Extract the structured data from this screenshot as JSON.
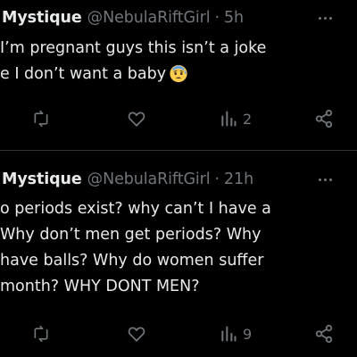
{
  "tweets": [
    {
      "display_name": "Mystique",
      "handle": "@NebulaRiftGirl",
      "separator": "·",
      "time": "5h",
      "lines": [
        "I’m pregnant guys this isn’t a joke",
        "e I don’t want a baby"
      ],
      "emoji": "anxious-face-with-sweat",
      "views": "2",
      "icons": [
        "reply-icon",
        "heart-icon",
        "views-chart-icon",
        "share-icon",
        "more-icon"
      ]
    },
    {
      "display_name": "Mystique",
      "handle": "@NebulaRiftGirl",
      "separator": "·",
      "time": "21h",
      "lines": [
        "o periods exist? why can’t I have a",
        " Why don’t men get periods? Why",
        "have balls? Why do women suffer",
        " month? WHY DONT MEN?"
      ],
      "views": "9",
      "icons": [
        "reply-icon",
        "heart-icon",
        "views-chart-icon",
        "share-icon",
        "more-icon"
      ]
    }
  ],
  "colors": {
    "background": "#000000",
    "text": "#e7e9ea",
    "muted": "#71767b",
    "divider": "#2f3336"
  }
}
